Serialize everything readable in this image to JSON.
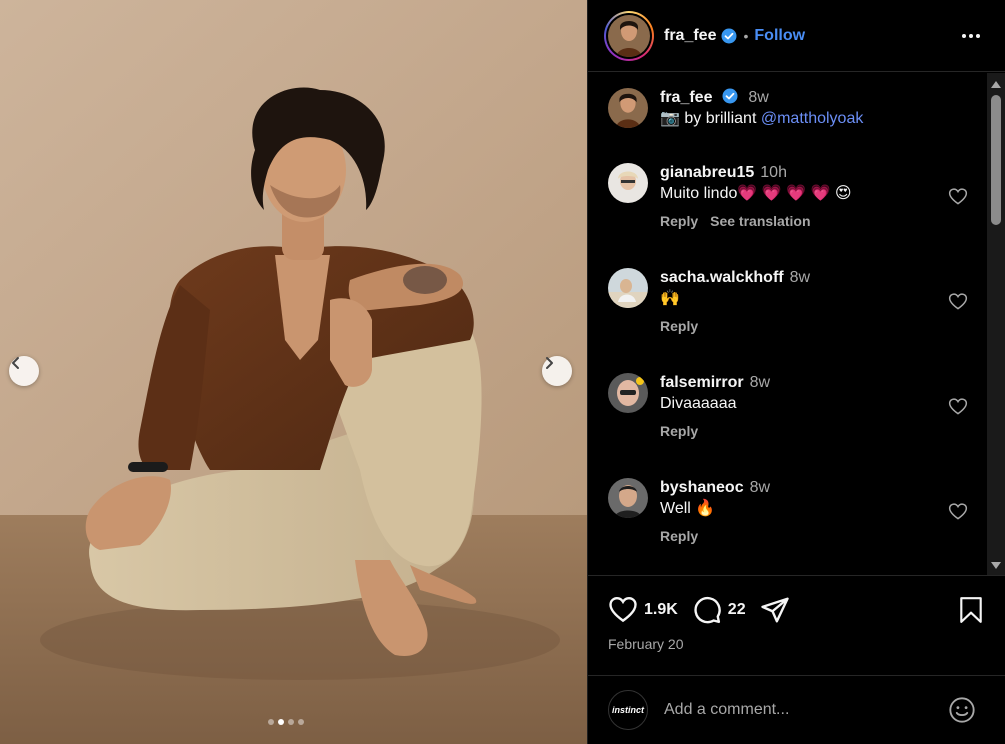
{
  "post": {
    "author": "fra_fee",
    "verified": true,
    "separator": "•",
    "follow_label": "Follow"
  },
  "caption": {
    "username": "fra_fee",
    "time": "8w",
    "camera_emoji": "📷",
    "text": " by brilliant ",
    "mention": "@mattholyoak"
  },
  "comments": [
    {
      "username": "gianabreu15",
      "time": "10h",
      "text": "Muito lindo💗 💗 💗 💗 😍",
      "reply": "Reply",
      "translate": "See translation"
    },
    {
      "username": "sacha.walckhoff",
      "time": "8w",
      "text": "🙌",
      "reply": "Reply"
    },
    {
      "username": "falsemirror",
      "time": "8w",
      "text": "Divaaaaaa",
      "reply": "Reply"
    },
    {
      "username": "byshaneoc",
      "time": "8w",
      "text": "Well 🔥",
      "reply": "Reply"
    }
  ],
  "stats": {
    "likes": "1.9K",
    "comments": "22",
    "date": "February 20"
  },
  "composer": {
    "avatar_text": "instinct",
    "placeholder": "Add a comment..."
  },
  "carousel": {
    "total_slides": 4,
    "active_slide": 2
  },
  "colors": {
    "accent_blue": "#4a8ef5",
    "mention_blue": "#6b8ef5",
    "background": "#000000",
    "muted_text": "#a8a8a8",
    "heart_emoji": "#ff2d6f"
  },
  "icons": [
    "verified-badge-icon",
    "more-options-icon",
    "heart-icon",
    "comment-icon",
    "share-icon",
    "bookmark-icon",
    "emoji-icon",
    "chevron-left-icon",
    "chevron-right-icon"
  ]
}
